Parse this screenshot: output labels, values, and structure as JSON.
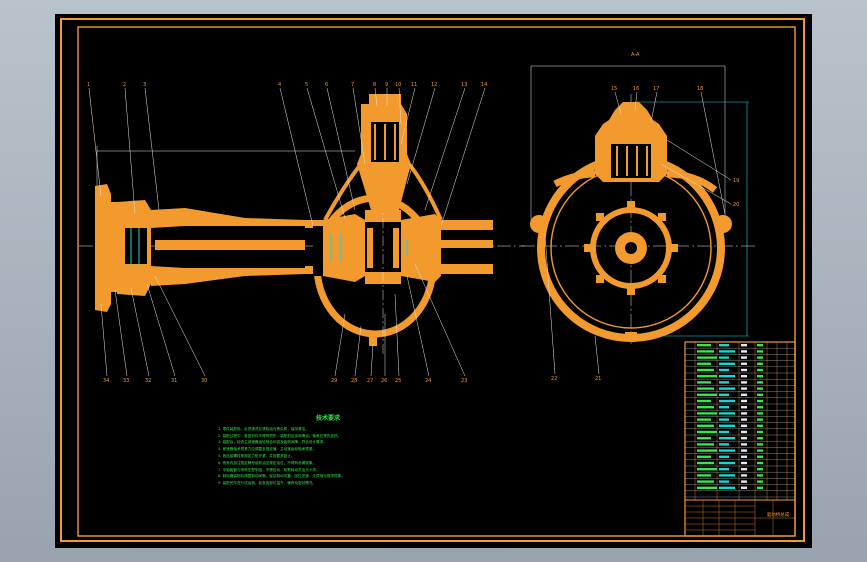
{
  "drawing": {
    "technical_notes": {
      "title": "技术要求",
      "lines": [
        "1. 零件装配前，必须清洗并清除油污等杂质，保持清洁。",
        "2. 装配过程中，各密封件不得有损伤，装配前应涂润滑油，轴承应预先加热。",
        "3. 装配后，检查主减速器齿轮啮合印迹及齿侧间隙，符合设计要求。",
        "4. 差速器轴承预紧力应调整至规定值，主动锥齿轮轴承预紧。",
        "5. 各连接螺栓按规定力矩拧紧，并按要求锁止。",
        "6. 桥壳内加注规定牌号齿轮油至规定油位，不得有渗漏现象。",
        "7. 半轴套管与桥壳压配牢固，不得松动，轮毂转动灵活无卡滞。",
        "8. 制动器装配后调整制动间隙，保证制动可靠，回位迅速，无异响无拖滞现象。",
        "9. 装配完毕进行试运转，检查各部位温升、噪声及密封情况。"
      ]
    },
    "section_label": "A-A",
    "callouts_top_left": [
      "1",
      "2",
      "3",
      "4",
      "5",
      "6",
      "7",
      "8",
      "9",
      "10",
      "11",
      "12",
      "13",
      "14"
    ],
    "callouts_bottom_left": [
      "34",
      "33",
      "32",
      "31",
      "30",
      "29",
      "28",
      "27",
      "26",
      "25",
      "24",
      "23"
    ],
    "callouts_right": [
      "15",
      "16",
      "17",
      "18",
      "19",
      "20",
      "22",
      "21"
    ],
    "title_block": {
      "drawing_title": "驱动桥总成"
    }
  }
}
